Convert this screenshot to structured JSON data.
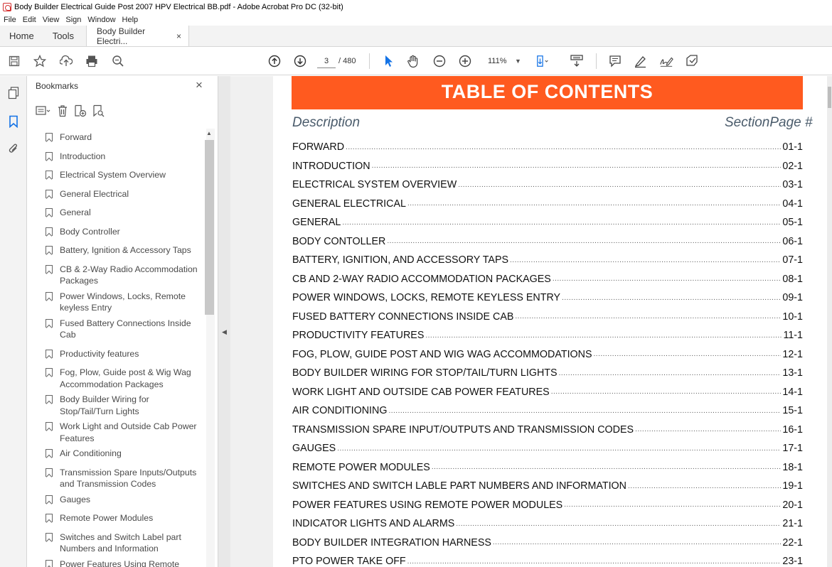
{
  "window": {
    "title": "Body Builder Electrical Guide Post 2007 HPV Electrical BB.pdf - Adobe Acrobat Pro DC (32-bit)"
  },
  "menu": [
    "File",
    "Edit",
    "View",
    "Sign",
    "Window",
    "Help"
  ],
  "tabs": {
    "home": "Home",
    "tools": "Tools",
    "document": "Body Builder Electri...",
    "close": "×"
  },
  "toolbar": {
    "current_page": "3",
    "total_pages": "/ 480",
    "zoom": "111%",
    "icons": [
      "save-icon",
      "star-icon",
      "upload-icon",
      "print-icon",
      "zoom-search-icon",
      "prev-page-icon",
      "next-page-icon",
      "select-cursor-icon",
      "hand-icon",
      "zoom-out-icon",
      "zoom-in-icon",
      "page-display-icon",
      "scroll-mode-icon",
      "comment-icon",
      "highlight-icon",
      "sign-icon",
      "tag-icon"
    ]
  },
  "bookmarks": {
    "title": "Bookmarks",
    "close": "×",
    "items": [
      "Forward",
      "Introduction",
      "Electrical System Overview",
      "General Electrical",
      "General",
      "Body Controller",
      "Battery, Ignition & Accessory Taps",
      "CB & 2-Way Radio Accommodation Packages",
      "Power Windows, Locks, Remote keyless Entry",
      "Fused Battery Connections Inside Cab",
      "Productivity features",
      "Fog, Plow, Guide post & Wig Wag Accommodation Packages",
      "Body Builder Wiring for Stop/Tail/Turn Lights",
      "Work Light and Outside Cab Power Features",
      "Air Conditioning",
      "Transmission Spare Inputs/Outputs and Transmission Codes",
      "Gauges",
      "Remote Power Modules",
      "Switches and Switch Label part Numbers and Information",
      "Power Features Using Remote Power Modules"
    ]
  },
  "document": {
    "header": "TABLE OF CONTENTS",
    "col_description": "Description",
    "col_section": "SectionPage #",
    "accent_color": "#ff5a1f",
    "rows": [
      {
        "title": "FORWARD",
        "page": "01-1"
      },
      {
        "title": "INTRODUCTION",
        "page": "02-1"
      },
      {
        "title": "ELECTRICAL SYSTEM OVERVIEW",
        "page": "03-1"
      },
      {
        "title": "GENERAL ELECTRICAL",
        "page": "04-1"
      },
      {
        "title": "GENERAL",
        "page": "05-1"
      },
      {
        "title": "BODY CONTOLLER",
        "page": "06-1"
      },
      {
        "title": "BATTERY, IGNITION, AND ACCESSORY TAPS",
        "page": "07-1"
      },
      {
        "title": "CB AND 2-WAY RADIO ACCOMMODATION PACKAGES",
        "page": "08-1"
      },
      {
        "title": "POWER WINDOWS, LOCKS, REMOTE KEYLESS ENTRY",
        "page": "09-1"
      },
      {
        "title": "FUSED BATTERY CONNECTIONS INSIDE CAB",
        "page": "10-1"
      },
      {
        "title": "PRODUCTIVITY FEATURES",
        "page": "11-1"
      },
      {
        "title": "FOG, PLOW, GUIDE POST AND WIG WAG ACCOMMODATIONS",
        "page": "12-1"
      },
      {
        "title": "BODY BUILDER WIRING FOR STOP/TAIL/TURN LIGHTS",
        "page": "13-1"
      },
      {
        "title": "WORK LIGHT AND OUTSIDE CAB POWER FEATURES",
        "page": "14-1"
      },
      {
        "title": "AIR CONDITIONING",
        "page": "15-1"
      },
      {
        "title": "TRANSMISSION SPARE INPUT/OUTPUTS AND TRANSMISSION CODES",
        "page": "16-1"
      },
      {
        "title": "GAUGES",
        "page": "17-1"
      },
      {
        "title": "REMOTE POWER MODULES",
        "page": "18-1"
      },
      {
        "title": "SWITCHES AND SWITCH LABLE PART NUMBERS AND INFORMATION",
        "page": "19-1"
      },
      {
        "title": "POWER FEATURES USING REMOTE POWER MODULES",
        "page": "20-1"
      },
      {
        "title": "INDICATOR LIGHTS AND ALARMS",
        "page": "21-1"
      },
      {
        "title": "BODY BUILDER INTEGRATION HARNESS",
        "page": "22-1"
      },
      {
        "title": "PTO POWER TAKE OFF",
        "page": "23-1"
      }
    ]
  }
}
